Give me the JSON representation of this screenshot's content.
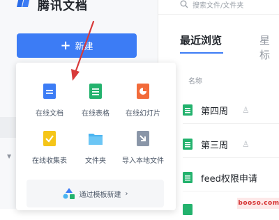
{
  "app": {
    "logo_text": "腾讯文档"
  },
  "sidebar": {
    "new_label": "新建"
  },
  "search": {
    "placeholder": "搜索文件/文件夹"
  },
  "tabs": [
    {
      "label": "最近浏览",
      "active": true
    },
    {
      "label": "星标",
      "active": false
    }
  ],
  "list": {
    "column_header": "名称",
    "files": [
      {
        "name": "第四周",
        "type": "sheet"
      },
      {
        "name": "第三周",
        "type": "sheet"
      },
      {
        "name": "feed权限申请",
        "type": "sheet"
      }
    ]
  },
  "new_menu": {
    "items": [
      {
        "label": "在线文档",
        "icon": "doc-icon",
        "color": "#3c7cf5"
      },
      {
        "label": "在线表格",
        "icon": "sheet-icon",
        "color": "#23b26d"
      },
      {
        "label": "在线幻灯片",
        "icon": "slides-icon",
        "color": "#f26b3a"
      },
      {
        "label": "在线收集表",
        "icon": "form-icon",
        "color": "#f5c518"
      },
      {
        "label": "文件夹",
        "icon": "folder-icon",
        "color": "#4ab4f0"
      },
      {
        "label": "导入本地文件",
        "icon": "import-icon",
        "color": "#8a96a8"
      }
    ],
    "template_label": "通过模板新建",
    "template_chevron": "›"
  },
  "watermark": {
    "text": "booso.com"
  },
  "colors": {
    "accent": "#3c7cf5",
    "annotation_arrow": "#d83a3a"
  }
}
